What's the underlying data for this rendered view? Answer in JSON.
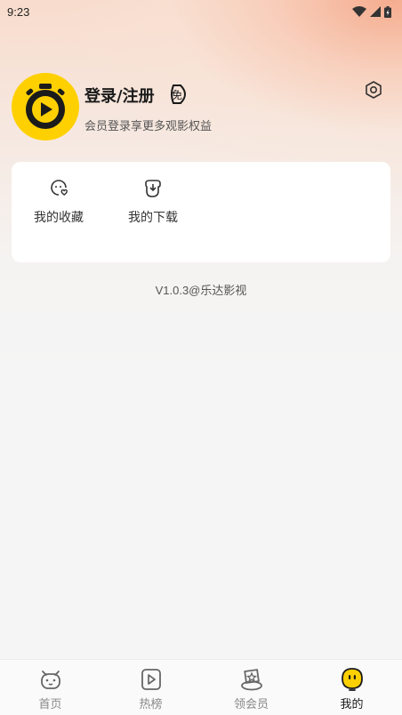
{
  "status_bar": {
    "time": "9:23",
    "icons": [
      "wifi-icon",
      "signal-icon",
      "battery-icon"
    ]
  },
  "profile": {
    "title": "登录/注册",
    "badge_icon": "free-badge-icon",
    "subtitle": "会员登录享更多观影权益",
    "avatar_icon": "play-stopwatch-icon",
    "settings_icon": "hexagon-settings-icon"
  },
  "shortcuts": [
    {
      "label": "我的收藏",
      "icon": "favorite-face-icon"
    },
    {
      "label": "我的下载",
      "icon": "download-cup-icon"
    }
  ],
  "version": "V1.0.3@乐达影视",
  "tabbar": {
    "tabs": [
      {
        "label": "首页",
        "icon": "home-face-icon",
        "active": false
      },
      {
        "label": "热榜",
        "icon": "play-square-icon",
        "active": false
      },
      {
        "label": "领会员",
        "icon": "vip-cup-icon",
        "active": false
      },
      {
        "label": "我的",
        "icon": "smiley-yellow-icon",
        "active": true
      }
    ]
  },
  "colors": {
    "brand_yellow": "#ffd000",
    "avatar_dark": "#1b1b1b",
    "gradient_peach": "#f5aa8c",
    "background": "#f5f5f5",
    "text_dark": "#1a1a1a",
    "text_muted": "#888888"
  }
}
